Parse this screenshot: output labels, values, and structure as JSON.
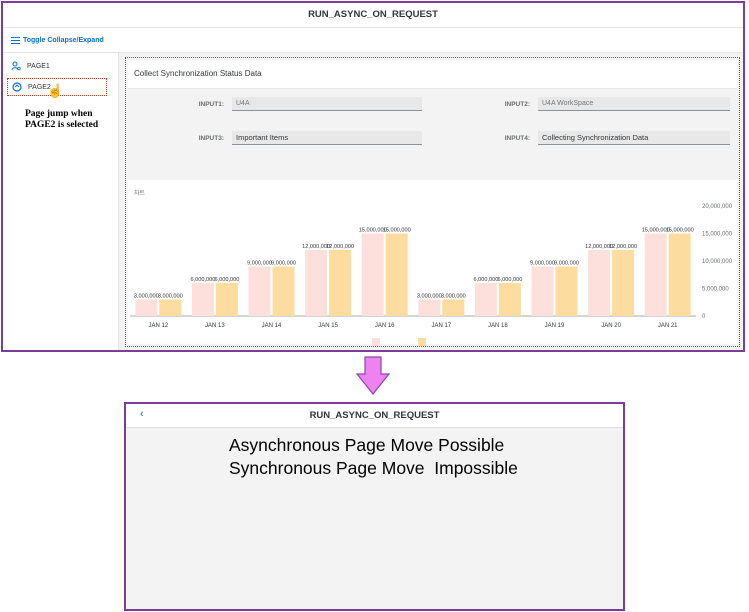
{
  "app_top": {
    "title": "RUN_ASYNC_ON_REQUEST",
    "toolbar": {
      "toggle_label": "Toggle Collapse/Expand"
    },
    "sidebar": {
      "items": [
        {
          "label": "PAGE1",
          "icon": "user-settings-icon"
        },
        {
          "label": "PAGE2",
          "icon": "sync-icon"
        }
      ],
      "annotation": "Page jump when PAGE2 is selected"
    },
    "panel": {
      "title": "Collect Synchronization Status Data",
      "fields": [
        {
          "label": "INPUT1:",
          "value": "U4A"
        },
        {
          "label": "INPUT2:",
          "value": "U4A WorkSpace"
        },
        {
          "label": "INPUT3:",
          "value": "Important Items"
        },
        {
          "label": "INPUT4:",
          "value": "Collecting Synchronization Data"
        }
      ],
      "chart_caption": "차트"
    }
  },
  "chart_data": {
    "type": "bar",
    "categories": [
      "JAN 12",
      "JAN 13",
      "JAN 14",
      "JAN 15",
      "JAN 16",
      "JAN 17",
      "JAN 18",
      "JAN 19",
      "JAN 20",
      "JAN 21"
    ],
    "series": [
      {
        "values": [
          3000000,
          6000000,
          9000000,
          12000000,
          15000000,
          3000000,
          6000000,
          9000000,
          12000000,
          15000000
        ],
        "color": "#fde0dc"
      },
      {
        "values": [
          3000000,
          6000000,
          9000000,
          12000000,
          15000000,
          3000000,
          6000000,
          9000000,
          12000000,
          15000000
        ],
        "color": "#fddca0"
      }
    ],
    "data_labels": [
      "3,000,000",
      "6,000,000",
      "9,000,000",
      "12,000,000",
      "15,000,000",
      "3,000,000",
      "6,000,000",
      "9,000,000",
      "12,000,000",
      "15,000,000"
    ],
    "y_ticks": [
      "0",
      "5,000,000",
      "10,000,000",
      "15,000,000",
      "20,000,000"
    ],
    "ylim": [
      0,
      20000000
    ],
    "y_axis_side": "right",
    "legend_position": "bottom",
    "grid": false
  },
  "app_bottom": {
    "title": "RUN_ASYNC_ON_REQUEST",
    "back_label": "‹",
    "message_line1": "Asynchronous Page Move Possible",
    "message_line2": "Synchronous Page Move  Impossible"
  },
  "colors": {
    "accent": "#0a6ed1",
    "frame": "#7d3c98",
    "highlight": "#c0392b",
    "arrow": "#ee82ee"
  }
}
